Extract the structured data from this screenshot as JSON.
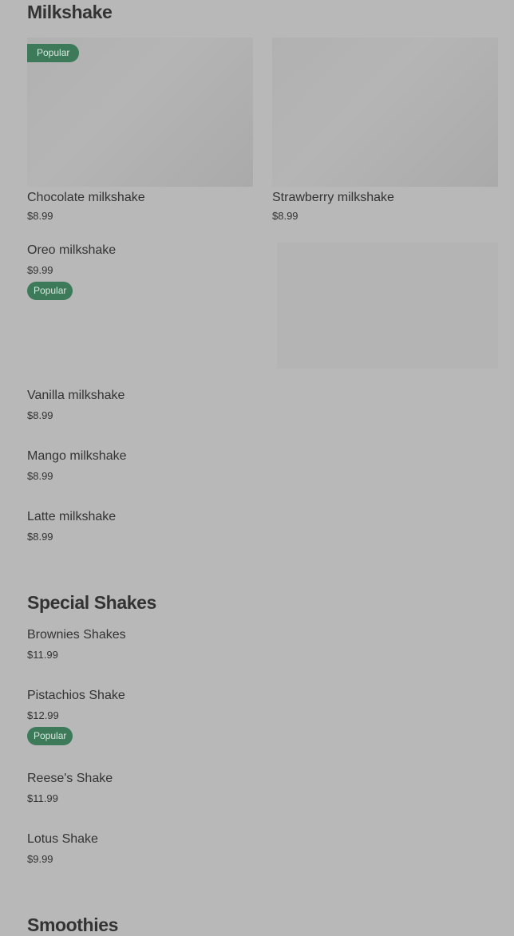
{
  "sections": {
    "milkshake": {
      "title": "Milkshake",
      "featured": [
        {
          "name": "Chocolate milkshake",
          "price": "$8.99",
          "badge": "Popular"
        },
        {
          "name": "Strawberry milkshake",
          "price": "$8.99"
        }
      ],
      "items": [
        {
          "name": "Oreo milkshake",
          "price": "$9.99",
          "badge": "Popular"
        },
        {
          "name": "Vanilla milkshake",
          "price": "$8.99"
        },
        {
          "name": "Mango milkshake",
          "price": "$8.99"
        },
        {
          "name": "Latte milkshake",
          "price": "$8.99"
        }
      ]
    },
    "special": {
      "title": "Special Shakes",
      "items": [
        {
          "name": "Brownies Shakes",
          "price": "$11.99"
        },
        {
          "name": "Pistachios Shake",
          "price": "$12.99",
          "badge": "Popular"
        },
        {
          "name": "Reese's Shake",
          "price": "$11.99"
        },
        {
          "name": "Lotus Shake",
          "price": "$9.99"
        }
      ]
    },
    "smoothies": {
      "title": "Smoothies"
    }
  },
  "colors": {
    "background": "#b8b8b8",
    "text": "#333333",
    "badge_background": "#3d7a5a",
    "badge_text": "#d9e8df"
  }
}
